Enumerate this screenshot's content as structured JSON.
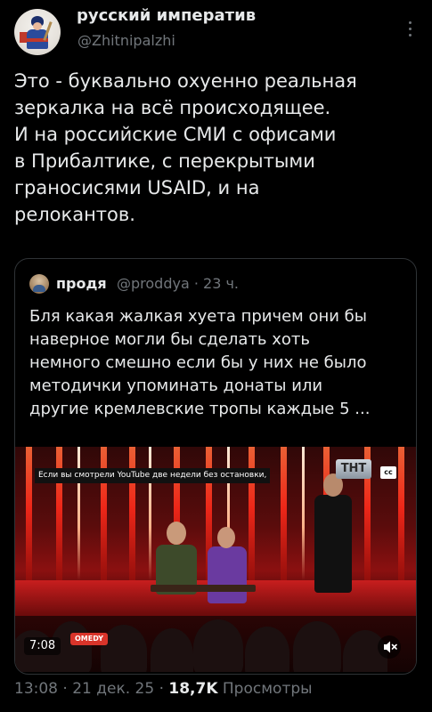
{
  "author": {
    "display_name": "русский императив",
    "handle": "@Zhitnipalzhi"
  },
  "tweet": {
    "text": "Это - буквально охуенно реальная\nзеркалка на всё происходящее.\nИ на российские СМИ с офисами\nв Прибалтике, с перекрытыми\nграносисями USAID, и на\nрелокантов."
  },
  "quote": {
    "display_name": "продя",
    "meta": "@proddya · 23 ч.",
    "text": "Бля какая жалкая хуета причем они бы\nнаверное могли бы сделать хоть\nнемного смешно если бы у них не было\nметодички упоминать донаты или\nдругие кремлевские тропы каждые 5 ...",
    "video": {
      "caption": "Если вы смотрели YouTube две недели без остановки,",
      "channel_logo": "ТНТ",
      "cc_label": "cc",
      "comedy_badge": "OMEDY",
      "duration": "7:08",
      "mute_icon": "speaker-muted-icon"
    }
  },
  "footer": {
    "time_date": "13:08 · 21 дек. 25 · ",
    "views_count": "18,7K",
    "views_label": " Просмотры"
  },
  "colors": {
    "background": "#000000",
    "text_primary": "#e7e9ea",
    "text_secondary": "#71767b",
    "border": "#2f3336"
  }
}
